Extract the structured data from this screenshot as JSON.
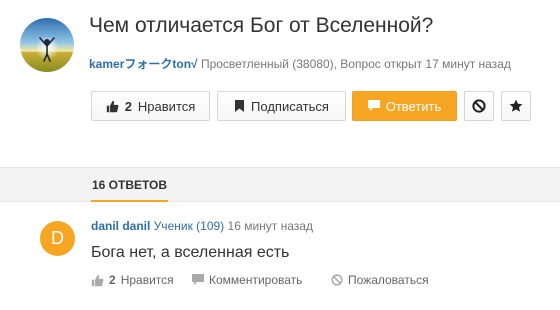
{
  "question": {
    "title": "Чем отличается Бог от Вселенной?",
    "author": "kamerフォークton√",
    "meta_text": " Просветленный (38080), Вопрос открыт 17 минут назад",
    "avatar_icon": "person-sunrise-field-avatar"
  },
  "actions": {
    "like_count": "2",
    "like_label": "Нравится",
    "subscribe_label": "Подписаться",
    "answer_label": "Ответить",
    "block_icon": "block-icon",
    "star_icon": "star-icon"
  },
  "tabs": {
    "answers_label": "16 ОТВЕТОВ"
  },
  "answer": {
    "avatar_letter": "D",
    "author": "danil danil",
    "rank": "Ученик (109)",
    "time": "16 минут назад",
    "text": "Бога нет, а вселенная есть",
    "like_count": "2",
    "like_label": "Нравится",
    "comment_label": "Комментировать",
    "report_label": "Пожаловаться"
  },
  "colors": {
    "accent": "#f6a623",
    "link": "#2e6ea8",
    "tabbar_bg": "#f3f3f3"
  }
}
